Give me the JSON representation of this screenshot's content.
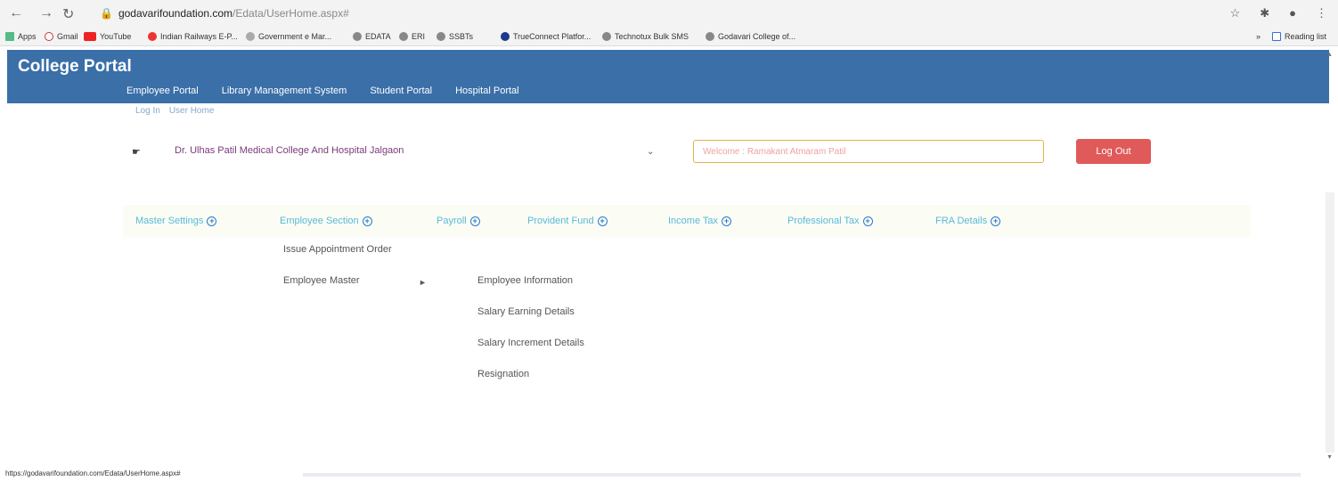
{
  "browser": {
    "url_host": "godavarifoundation.com",
    "url_path": "/Edata/UserHome.aspx#",
    "bookmarks": [
      "Apps",
      "Gmail",
      "YouTube",
      "Indian Railways E-P...",
      "Government e Mar...",
      "EDATA",
      "ERI",
      "SSBTs",
      "TrueConnect Platfor...",
      "Technotux Bulk SMS",
      "Godavari College of...",
      "»",
      "Reading list"
    ],
    "icons": [
      "back-icon",
      "forward-icon",
      "reload-icon",
      "lock-icon",
      "star-icon",
      "extensions-icon",
      "profile-icon",
      "menu-icon"
    ]
  },
  "header": {
    "title": "College Portal",
    "nav": [
      "Employee Portal",
      "Library Management System",
      "Student Portal",
      "Hospital Portal"
    ]
  },
  "breadcrumb": [
    "Log In",
    "User Home"
  ],
  "college": {
    "selected": "Dr. Ulhas Patil Medical College And Hospital Jalgaon",
    "welcome": "Welcome : Ramakant Atmaram Patil",
    "logout_label": "Log Out"
  },
  "menu": {
    "items": [
      "Master Settings",
      "Employee Section",
      "Payroll",
      "Provident Fund",
      "Income Tax",
      "Professional Tax",
      "FRA Details"
    ]
  },
  "dropdown_employee": {
    "items": [
      "Issue Appointment Order",
      "Employee Master"
    ]
  },
  "dropdown_master": {
    "items": [
      "Employee Information",
      "Salary Earning Details",
      "Salary Increment Details",
      "Resignation"
    ]
  },
  "status": {
    "url": "https://godavarifoundation.com/Edata/UserHome.aspx#"
  },
  "colors": {
    "header_bg": "#3a6fa8",
    "menu_text": "#58b8d8",
    "logout_bg": "#e05a5a",
    "welcome_border": "#e8b04a"
  }
}
